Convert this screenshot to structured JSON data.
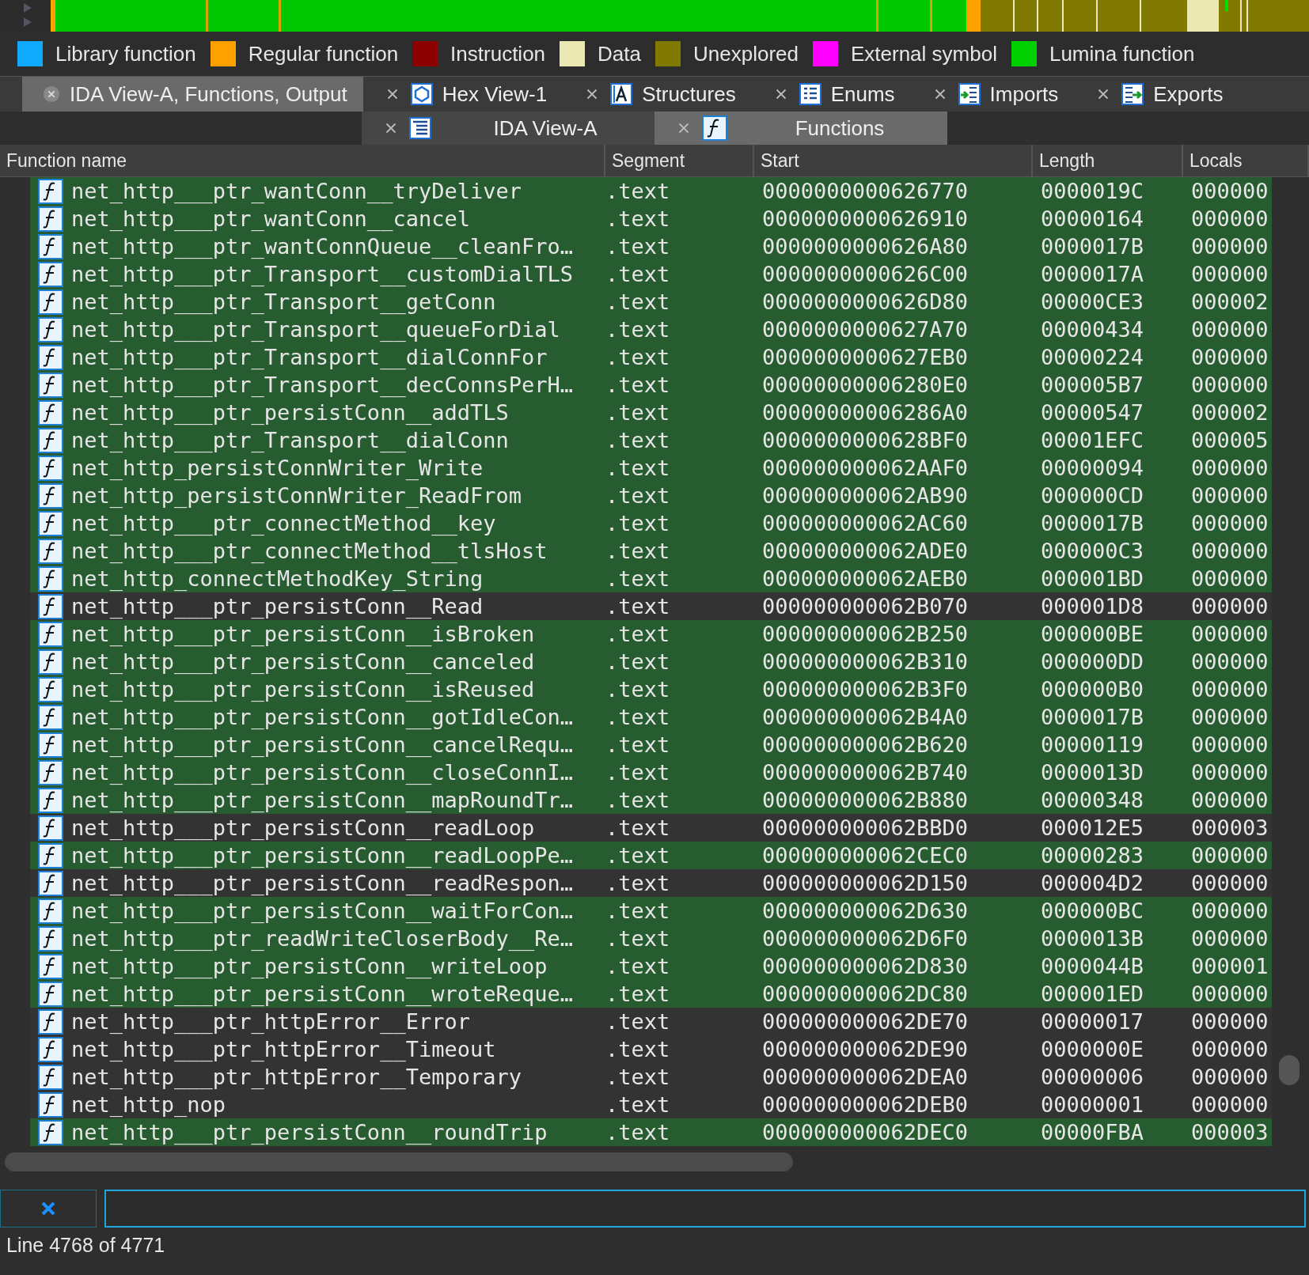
{
  "legend": [
    {
      "label": "Library function",
      "color": "#10aaff"
    },
    {
      "label": "Regular function",
      "color": "#ffa200"
    },
    {
      "label": "Instruction",
      "color": "#8b0000"
    },
    {
      "label": "Data",
      "color": "#ece8b4"
    },
    {
      "label": "Unexplored",
      "color": "#807a00"
    },
    {
      "label": "External symbol",
      "color": "#ff00ff"
    },
    {
      "label": "Lumina function",
      "color": "#00d000"
    }
  ],
  "tabs": [
    {
      "label": "IDA View-A, Functions, Output",
      "selected": true
    },
    {
      "label": "Hex View-1",
      "selected": false
    },
    {
      "label": "Structures",
      "selected": false
    },
    {
      "label": "Enums",
      "selected": false
    },
    {
      "label": "Imports",
      "selected": false
    },
    {
      "label": "Exports",
      "selected": false
    }
  ],
  "subtabs": [
    {
      "label": "IDA View-A",
      "selected": false
    },
    {
      "label": "Functions",
      "selected": true
    }
  ],
  "table": {
    "columns": [
      "Function name",
      "Segment",
      "Start",
      "Length",
      "Locals"
    ],
    "rows": [
      {
        "name": "net_http___ptr_wantConn__tryDeliver",
        "segment": ".text",
        "start": "0000000000626770",
        "length": "0000019C",
        "locals": "000000",
        "lumina": true
      },
      {
        "name": "net_http___ptr_wantConn__cancel",
        "segment": ".text",
        "start": "0000000000626910",
        "length": "00000164",
        "locals": "000000",
        "lumina": true
      },
      {
        "name": "net_http___ptr_wantConnQueue__cleanFro…",
        "segment": ".text",
        "start": "0000000000626A80",
        "length": "0000017B",
        "locals": "000000",
        "lumina": true
      },
      {
        "name": "net_http___ptr_Transport__customDialTLS",
        "segment": ".text",
        "start": "0000000000626C00",
        "length": "0000017A",
        "locals": "000000",
        "lumina": true
      },
      {
        "name": "net_http___ptr_Transport__getConn",
        "segment": ".text",
        "start": "0000000000626D80",
        "length": "00000CE3",
        "locals": "000002",
        "lumina": true
      },
      {
        "name": "net_http___ptr_Transport__queueForDial",
        "segment": ".text",
        "start": "0000000000627A70",
        "length": "00000434",
        "locals": "000000",
        "lumina": true
      },
      {
        "name": "net_http___ptr_Transport__dialConnFor",
        "segment": ".text",
        "start": "0000000000627EB0",
        "length": "00000224",
        "locals": "000000",
        "lumina": true
      },
      {
        "name": "net_http___ptr_Transport__decConnsPerH…",
        "segment": ".text",
        "start": "00000000006280E0",
        "length": "000005B7",
        "locals": "000000",
        "lumina": true
      },
      {
        "name": "net_http___ptr_persistConn__addTLS",
        "segment": ".text",
        "start": "00000000006286A0",
        "length": "00000547",
        "locals": "000002",
        "lumina": true
      },
      {
        "name": "net_http___ptr_Transport__dialConn",
        "segment": ".text",
        "start": "0000000000628BF0",
        "length": "00001EFC",
        "locals": "000005",
        "lumina": true
      },
      {
        "name": "net_http_persistConnWriter_Write",
        "segment": ".text",
        "start": "000000000062AAF0",
        "length": "00000094",
        "locals": "000000",
        "lumina": true
      },
      {
        "name": "net_http_persistConnWriter_ReadFrom",
        "segment": ".text",
        "start": "000000000062AB90",
        "length": "000000CD",
        "locals": "000000",
        "lumina": true
      },
      {
        "name": "net_http___ptr_connectMethod__key",
        "segment": ".text",
        "start": "000000000062AC60",
        "length": "0000017B",
        "locals": "000000",
        "lumina": true
      },
      {
        "name": "net_http___ptr_connectMethod__tlsHost",
        "segment": ".text",
        "start": "000000000062ADE0",
        "length": "000000C3",
        "locals": "000000",
        "lumina": true
      },
      {
        "name": "net_http_connectMethodKey_String",
        "segment": ".text",
        "start": "000000000062AEB0",
        "length": "000001BD",
        "locals": "000000",
        "lumina": true
      },
      {
        "name": "net_http___ptr_persistConn__Read",
        "segment": ".text",
        "start": "000000000062B070",
        "length": "000001D8",
        "locals": "000000",
        "lumina": false
      },
      {
        "name": "net_http___ptr_persistConn__isBroken",
        "segment": ".text",
        "start": "000000000062B250",
        "length": "000000BE",
        "locals": "000000",
        "lumina": true
      },
      {
        "name": "net_http___ptr_persistConn__canceled",
        "segment": ".text",
        "start": "000000000062B310",
        "length": "000000DD",
        "locals": "000000",
        "lumina": true
      },
      {
        "name": "net_http___ptr_persistConn__isReused",
        "segment": ".text",
        "start": "000000000062B3F0",
        "length": "000000B0",
        "locals": "000000",
        "lumina": true
      },
      {
        "name": "net_http___ptr_persistConn__gotIdleCon…",
        "segment": ".text",
        "start": "000000000062B4A0",
        "length": "0000017B",
        "locals": "000000",
        "lumina": true
      },
      {
        "name": "net_http___ptr_persistConn__cancelRequ…",
        "segment": ".text",
        "start": "000000000062B620",
        "length": "00000119",
        "locals": "000000",
        "lumina": true
      },
      {
        "name": "net_http___ptr_persistConn__closeConnI…",
        "segment": ".text",
        "start": "000000000062B740",
        "length": "0000013D",
        "locals": "000000",
        "lumina": true
      },
      {
        "name": "net_http___ptr_persistConn__mapRoundTr…",
        "segment": ".text",
        "start": "000000000062B880",
        "length": "00000348",
        "locals": "000000",
        "lumina": true
      },
      {
        "name": "net_http___ptr_persistConn__readLoop",
        "segment": ".text",
        "start": "000000000062BBD0",
        "length": "000012E5",
        "locals": "000003",
        "lumina": false
      },
      {
        "name": "net_http___ptr_persistConn__readLoopPe…",
        "segment": ".text",
        "start": "000000000062CEC0",
        "length": "00000283",
        "locals": "000000",
        "lumina": true
      },
      {
        "name": "net_http___ptr_persistConn__readRespon…",
        "segment": ".text",
        "start": "000000000062D150",
        "length": "000004D2",
        "locals": "000000",
        "lumina": false
      },
      {
        "name": "net_http___ptr_persistConn__waitForCon…",
        "segment": ".text",
        "start": "000000000062D630",
        "length": "000000BC",
        "locals": "000000",
        "lumina": true
      },
      {
        "name": "net_http___ptr_readWriteCloserBody__Re…",
        "segment": ".text",
        "start": "000000000062D6F0",
        "length": "0000013B",
        "locals": "000000",
        "lumina": true
      },
      {
        "name": "net_http___ptr_persistConn__writeLoop",
        "segment": ".text",
        "start": "000000000062D830",
        "length": "0000044B",
        "locals": "000001",
        "lumina": true
      },
      {
        "name": "net_http___ptr_persistConn__wroteReque…",
        "segment": ".text",
        "start": "000000000062DC80",
        "length": "000001ED",
        "locals": "000000",
        "lumina": true
      },
      {
        "name": "net_http___ptr_httpError__Error",
        "segment": ".text",
        "start": "000000000062DE70",
        "length": "00000017",
        "locals": "000000",
        "lumina": false
      },
      {
        "name": "net_http___ptr_httpError__Timeout",
        "segment": ".text",
        "start": "000000000062DE90",
        "length": "0000000E",
        "locals": "000000",
        "lumina": false
      },
      {
        "name": "net_http___ptr_httpError__Temporary",
        "segment": ".text",
        "start": "000000000062DEA0",
        "length": "00000006",
        "locals": "000000",
        "lumina": false
      },
      {
        "name": "net_http_nop",
        "segment": ".text",
        "start": "000000000062DEB0",
        "length": "00000001",
        "locals": "000000",
        "lumina": false
      },
      {
        "name": "net_http___ptr_persistConn__roundTrip",
        "segment": ".text",
        "start": "000000000062DEC0",
        "length": "00000FBA",
        "locals": "000003",
        "lumina": true
      }
    ]
  },
  "status_bar": "Line 4768 of 4771"
}
